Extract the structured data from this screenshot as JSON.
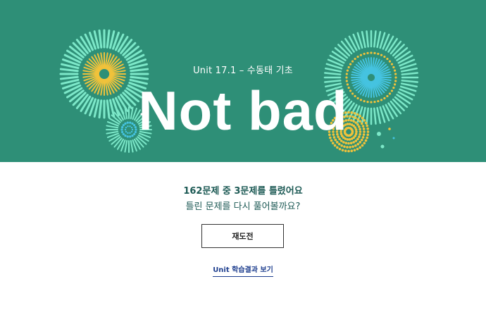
{
  "banner": {
    "unit_title": "Unit 17.1 – 수동태 기초",
    "headline": "Not bad",
    "colors": {
      "background": "#2e8f77",
      "mint": "#7de8c9",
      "yellow": "#f0c23b",
      "sky": "#45c3e0"
    }
  },
  "result": {
    "summary": "162문제 중 3문제를 틀렸어요",
    "prompt": "틀린 문제를 다시 풀어볼까요?"
  },
  "actions": {
    "retry_label": "재도전",
    "unit_result_link": "Unit 학습결과 보기"
  }
}
